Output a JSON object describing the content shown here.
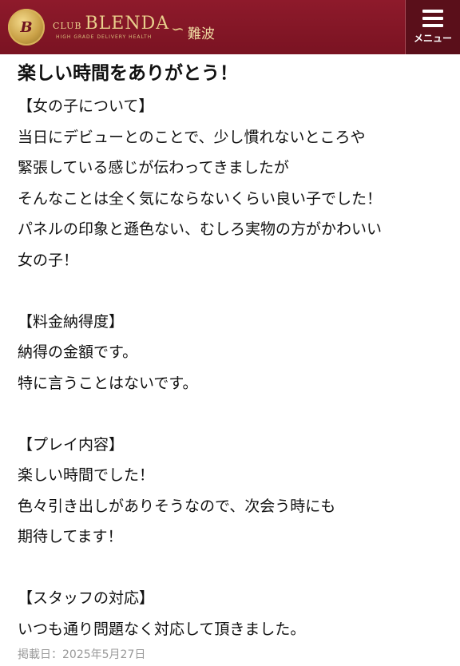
{
  "header": {
    "logo_club": "CLUB",
    "logo_name": "BLENDA",
    "logo_tagline": "HIGH GRADE DELIVERY HEALTH",
    "area": "難波",
    "menu_label": "メニュー"
  },
  "review": {
    "title": "楽しい時間をありがとう！",
    "sections": [
      {
        "heading": "【女の子について】",
        "lines": [
          "当日にデビューとのことで、少し慣れないところや",
          "緊張している感じが伝わってきましたが",
          "そんなことは全く気にならないくらい良い子でした！",
          "パネルの印象と遜色ない、むしろ実物の方がかわいい",
          "女の子！"
        ]
      },
      {
        "heading": "【料金納得度】",
        "lines": [
          "納得の金額です。",
          "特に言うことはないです。"
        ]
      },
      {
        "heading": "【プレイ内容】",
        "lines": [
          "楽しい時間でした！",
          "色々引き出しがありそうなので、次会う時にも",
          "期待してます！"
        ]
      },
      {
        "heading": "【スタッフの対応】",
        "lines": [
          "いつも通り問題なく対応して頂きました。"
        ]
      }
    ],
    "posted": "掲載日：2025年5月27日"
  }
}
